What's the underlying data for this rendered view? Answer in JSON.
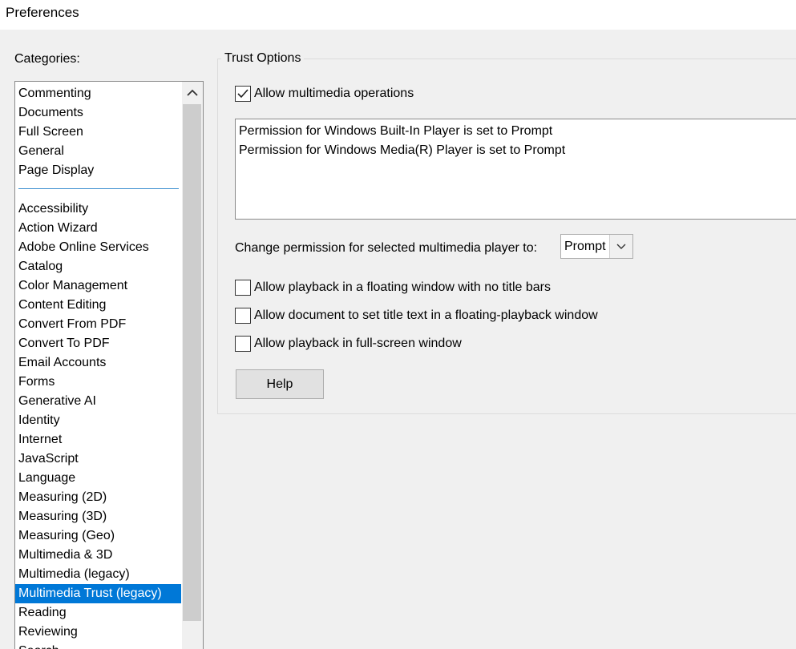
{
  "window": {
    "title": "Preferences"
  },
  "categories": {
    "label": "Categories:",
    "top_items": [
      "Commenting",
      "Documents",
      "Full Screen",
      "General",
      "Page Display"
    ],
    "items": [
      "Accessibility",
      "Action Wizard",
      "Adobe Online Services",
      "Catalog",
      "Color Management",
      "Content Editing",
      "Convert From PDF",
      "Convert To PDF",
      "Email Accounts",
      "Forms",
      "Generative AI",
      "Identity",
      "Internet",
      "JavaScript",
      "Language",
      "Measuring (2D)",
      "Measuring (3D)",
      "Measuring (Geo)",
      "Multimedia & 3D",
      "Multimedia (legacy)",
      "Multimedia Trust (legacy)",
      "Reading",
      "Reviewing",
      "Search"
    ],
    "selected": "Multimedia Trust (legacy)"
  },
  "trust_options": {
    "group_title": "Trust Options",
    "allow_multimedia": {
      "label": "Allow multimedia operations",
      "checked": true
    },
    "permissions": [
      "Permission for Windows Built-In Player is set to Prompt",
      "Permission for Windows Media(R) Player is set to Prompt"
    ],
    "change_label": "Change permission for selected multimedia player to:",
    "permission_value": "Prompt",
    "options": [
      {
        "label": "Allow playback in a floating window with no title bars",
        "checked": false
      },
      {
        "label": "Allow document to set title text in a floating-playback window",
        "checked": false
      },
      {
        "label": "Allow playback in full-screen window",
        "checked": false
      }
    ],
    "help_label": "Help"
  },
  "colors": {
    "selection": "#0078d7",
    "separator": "#3d8fd0"
  }
}
